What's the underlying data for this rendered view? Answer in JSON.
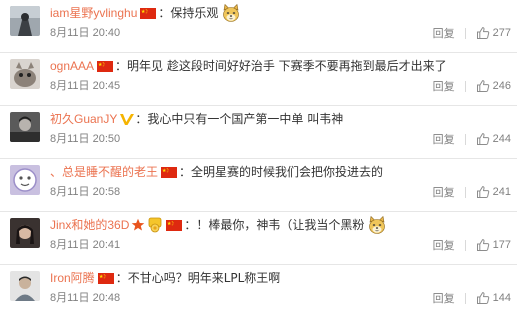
{
  "ui": {
    "reply_label": "回复",
    "accent_name_color": "#eb7350",
    "meta_color": "#808080"
  },
  "comments": [
    {
      "user": "iam星野yvlinghu",
      "flags": [
        "china-flag-icon"
      ],
      "text": "：保持乐观",
      "emoji": "doge-emoji-icon",
      "time": "8月11日 20:40",
      "likes": "277"
    },
    {
      "user": "ognAAA",
      "flags": [
        "china-flag-icon"
      ],
      "text": "：明年见 趁这段时间好好治手 下赛季不要再拖到最后才出来了",
      "time": "8月11日 20:45",
      "likes": "246"
    },
    {
      "user": "初久GuanJY",
      "badge": "verified-v-icon",
      "text": "：我心中只有一个国产第一中单 叫韦神",
      "time": "8月11日 20:50",
      "likes": "244"
    },
    {
      "user": "、总是睡不醒的老王",
      "flags": [
        "china-flag-icon"
      ],
      "text": "：全明星赛的时候我们会把你投进去的",
      "time": "8月11日 20:58",
      "likes": "241"
    },
    {
      "user": "Jinx和她的36D",
      "badges": [
        "star-badge-icon",
        "medal-badge-icon"
      ],
      "flags": [
        "china-flag-icon"
      ],
      "text": "：！棒最你，神韦（让我当个黑粉",
      "emoji": "doge-emoji-icon",
      "time": "8月11日 20:41",
      "likes": "177"
    },
    {
      "user": "Iron阿腾",
      "flags": [
        "china-flag-icon"
      ],
      "text": "：不甘心吗？明年来LPL称王啊",
      "time": "8月11日 20:48",
      "likes": "144"
    }
  ]
}
